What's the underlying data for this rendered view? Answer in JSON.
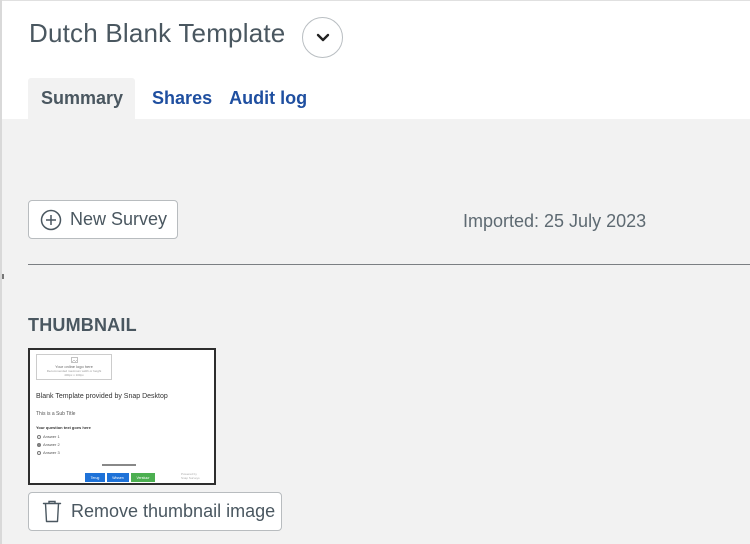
{
  "header": {
    "title": "Dutch Blank Template",
    "dropdown_icon": "chevron-down-icon"
  },
  "tabs": [
    {
      "label": "Summary",
      "active": true
    },
    {
      "label": "Shares",
      "active": false
    },
    {
      "label": "Audit log",
      "active": false
    }
  ],
  "actions": {
    "new_survey_label": "New Survey",
    "new_survey_icon": "plus-circle-icon"
  },
  "imported_text": "Imported: 25 July 2023",
  "thumbnail": {
    "heading": "THUMBNAIL",
    "preview": {
      "logo_line1": "Your online logo here",
      "logo_line2": "Recommended maximum width or height",
      "logo_line3": "400px x 100px",
      "title": "Blank Template provided by Snap Desktop",
      "subtitle": "This is a Sub Title",
      "question": "Your question text goes here",
      "answers": [
        {
          "label": "Answer 1",
          "selected": false
        },
        {
          "label": "Answer 2",
          "selected": true
        },
        {
          "label": "Answer 3",
          "selected": false
        }
      ],
      "buttons": [
        {
          "label": "Terug",
          "color": "#1e72d8"
        },
        {
          "label": "Wissen",
          "color": "#1e72d8"
        },
        {
          "label": "Verstuur",
          "color": "#4caf50"
        }
      ],
      "powered_line1": "Powered by",
      "powered_line2": "Snap Surveys"
    },
    "remove_label": "Remove thumbnail image",
    "remove_icon": "trash-icon"
  },
  "colors": {
    "link_blue": "#1f4fa0",
    "panel_bg": "#f2f2f2",
    "text_gray": "#4a5760"
  }
}
